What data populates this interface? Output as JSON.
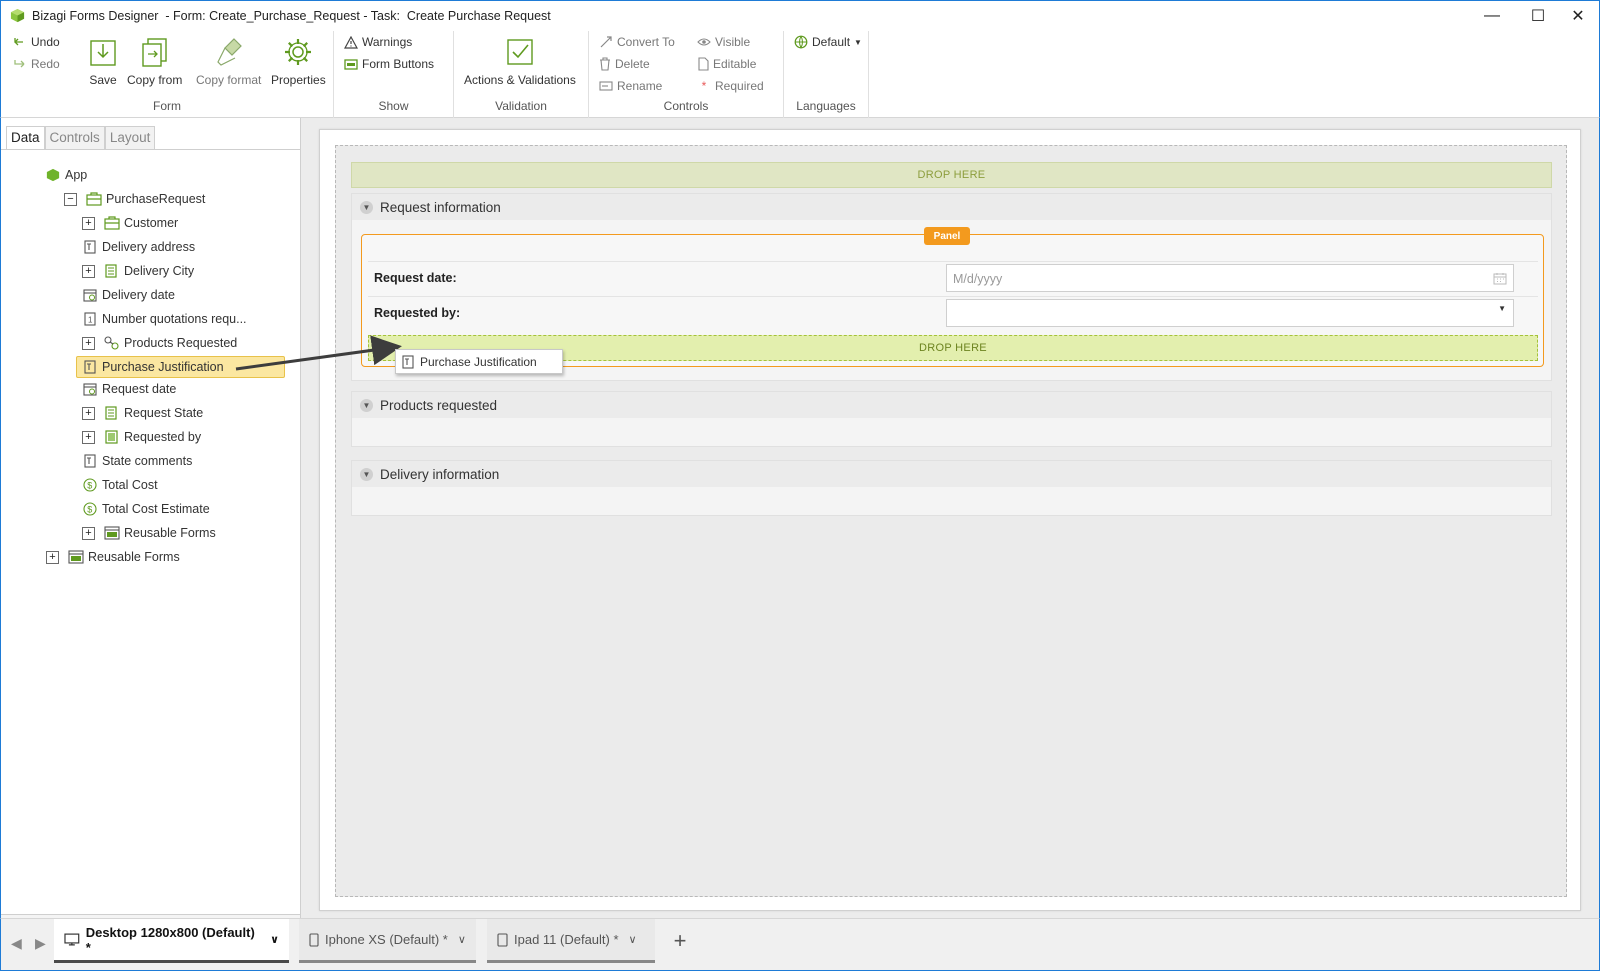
{
  "window": {
    "title": "Bizagi Forms Designer  - Form: Create_Purchase_Request - Task:  Create Purchase Request",
    "minimize": "—",
    "maximize": "☐",
    "close": "✕"
  },
  "ribbon": {
    "form_group": {
      "label": "Form",
      "undo": "Undo",
      "redo": "Redo",
      "save": "Save",
      "copy_from": "Copy from",
      "copy_format": "Copy format",
      "properties": "Properties"
    },
    "show_group": {
      "label": "Show",
      "warnings": "Warnings",
      "form_buttons": "Form Buttons"
    },
    "validation_group": {
      "label": "Validation",
      "actions_validations": "Actions & Validations"
    },
    "controls_group": {
      "label": "Controls",
      "convert_to": "Convert To",
      "delete": "Delete",
      "rename": "Rename",
      "visible": "Visible",
      "editable": "Editable",
      "required": "Required"
    },
    "languages_group": {
      "label": "Languages",
      "default": "Default"
    }
  },
  "left_panel": {
    "tabs": [
      "Data",
      "Controls",
      "Layout"
    ],
    "tree": {
      "root": "App",
      "entity": "PurchaseRequest",
      "items": [
        {
          "label": "Customer",
          "expandable": true
        },
        {
          "label": "Delivery address",
          "expandable": false
        },
        {
          "label": "Delivery City",
          "expandable": true
        },
        {
          "label": "Delivery date",
          "expandable": false
        },
        {
          "label": "Number quotations requ...",
          "expandable": false
        },
        {
          "label": "Products Requested",
          "expandable": true
        },
        {
          "label": "Purchase Justification",
          "expandable": false,
          "selected": true
        },
        {
          "label": "Request date",
          "expandable": false
        },
        {
          "label": "Request State",
          "expandable": true
        },
        {
          "label": "Requested by",
          "expandable": true
        },
        {
          "label": "State comments",
          "expandable": false
        },
        {
          "label": "Total Cost",
          "expandable": false
        },
        {
          "label": "Total Cost Estimate",
          "expandable": false
        },
        {
          "label": "Reusable Forms",
          "expandable": true
        }
      ],
      "root_reusable": "Reusable Forms"
    }
  },
  "canvas": {
    "drop_here_top": "DROP HERE",
    "groups": [
      {
        "title": "Request information"
      },
      {
        "title": "Products requested"
      },
      {
        "title": "Delivery information"
      }
    ],
    "panel_badge": "Panel",
    "fields": {
      "request_date_label": "Request date:",
      "request_date_placeholder": "M/d/yyyy",
      "requested_by_label": "Requested by:"
    },
    "drop_here_panel": "DROP HERE",
    "drag_ghost": "Purchase Justification"
  },
  "bottom_tabs": [
    {
      "label": "Desktop 1280x800 (Default) *",
      "active": true
    },
    {
      "label": "Iphone XS (Default) *",
      "active": false
    },
    {
      "label": "Ipad 11 (Default) *",
      "active": false
    }
  ],
  "add_tab": "+"
}
